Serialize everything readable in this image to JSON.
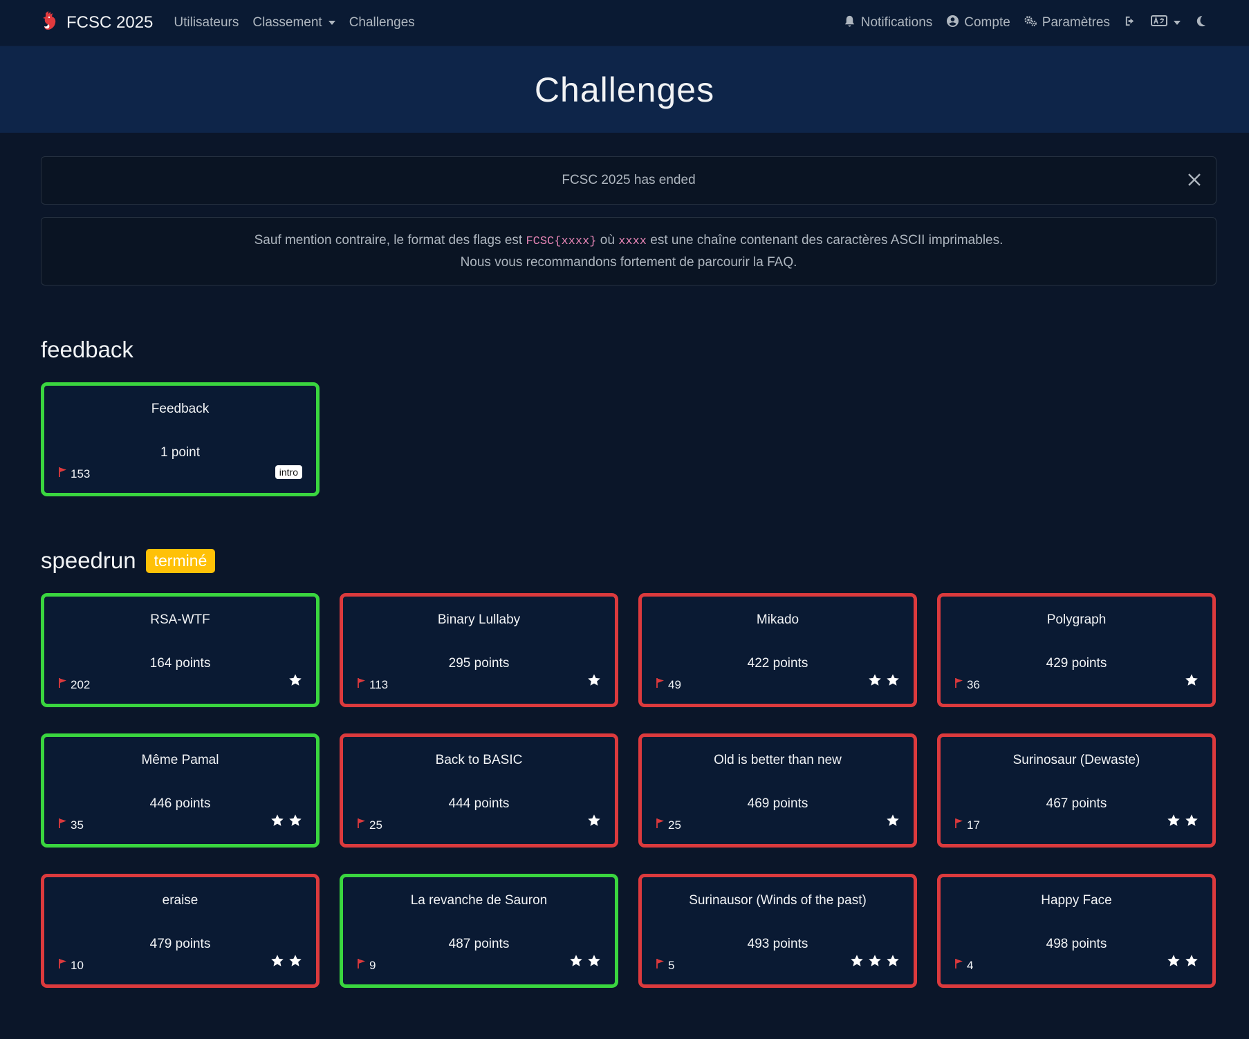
{
  "navbar": {
    "brand": "FCSC 2025",
    "links": [
      "Utilisateurs",
      "Classement",
      "Challenges"
    ],
    "right": {
      "notifications": "Notifications",
      "account": "Compte",
      "settings": "Paramètres"
    }
  },
  "hero": {
    "title": "Challenges"
  },
  "alert": {
    "text": "FCSC 2025 has ended"
  },
  "info": {
    "line1_before": "Sauf mention contraire, le format des flags est ",
    "line1_code1": "FCSC{xxxx}",
    "line1_middle": " où ",
    "line1_code2": "xxxx",
    "line1_after": " est une chaîne contenant des caractères ASCII imprimables.",
    "line2_before": "Nous vous recommandons fortement de parcourir la ",
    "line2_link": "FAQ",
    "line2_after": "."
  },
  "sections": [
    {
      "title": "feedback",
      "badge": "",
      "challenges": [
        {
          "name": "Feedback",
          "points": "1 point",
          "solves": "153",
          "stars": 0,
          "tag": "intro",
          "solved": true
        }
      ]
    },
    {
      "title": "speedrun",
      "badge": "terminé",
      "challenges": [
        {
          "name": "RSA-WTF",
          "points": "164 points",
          "solves": "202",
          "stars": 1,
          "tag": "",
          "solved": true
        },
        {
          "name": "Binary Lullaby",
          "points": "295 points",
          "solves": "113",
          "stars": 1,
          "tag": "",
          "solved": false
        },
        {
          "name": "Mikado",
          "points": "422 points",
          "solves": "49",
          "stars": 2,
          "tag": "",
          "solved": false
        },
        {
          "name": "Polygraph",
          "points": "429 points",
          "solves": "36",
          "stars": 1,
          "tag": "",
          "solved": false
        },
        {
          "name": "Même Pamal",
          "points": "446 points",
          "solves": "35",
          "stars": 2,
          "tag": "",
          "solved": true
        },
        {
          "name": "Back to BASIC",
          "points": "444 points",
          "solves": "25",
          "stars": 1,
          "tag": "",
          "solved": false
        },
        {
          "name": "Old is better than new",
          "points": "469 points",
          "solves": "25",
          "stars": 1,
          "tag": "",
          "solved": false
        },
        {
          "name": "Surinosaur (Dewaste)",
          "points": "467 points",
          "solves": "17",
          "stars": 2,
          "tag": "",
          "solved": false
        },
        {
          "name": "eraise",
          "points": "479 points",
          "solves": "10",
          "stars": 2,
          "tag": "",
          "solved": false
        },
        {
          "name": "La revanche de Sauron",
          "points": "487 points",
          "solves": "9",
          "stars": 2,
          "tag": "",
          "solved": true
        },
        {
          "name": "Surinausor (Winds of the past)",
          "points": "493 points",
          "solves": "5",
          "stars": 3,
          "tag": "",
          "solved": false
        },
        {
          "name": "Happy Face",
          "points": "498 points",
          "solves": "4",
          "stars": 2,
          "tag": "",
          "solved": false
        }
      ]
    }
  ],
  "colors": {
    "solved_border": "#3ad63f",
    "unsolved_border": "#dc3a3d",
    "flag": "#dc3a3d",
    "badge_done": "#ffc107"
  }
}
